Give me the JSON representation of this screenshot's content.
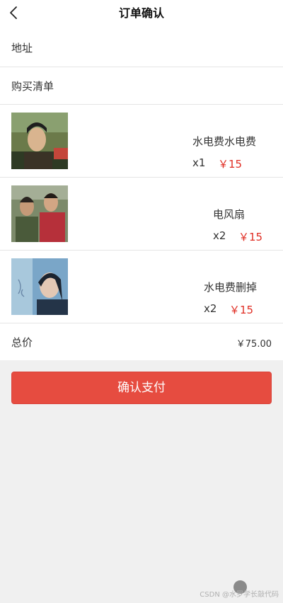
{
  "header": {
    "title": "订单确认",
    "back_icon": "chevron-left-icon"
  },
  "address": {
    "label": "地址"
  },
  "cart": {
    "label": "购买清单"
  },
  "items": [
    {
      "name": "水电费水电费",
      "qty": "x1",
      "price": "￥15"
    },
    {
      "name": "电风扇",
      "qty": "x2",
      "price": "￥15"
    },
    {
      "name": "水电费删掉",
      "qty": "x2",
      "price": "￥15"
    }
  ],
  "total": {
    "label": "总价",
    "value": "￥75.00"
  },
  "pay_button": {
    "label": "确认支付"
  },
  "watermark": "CSDN @水罗学长敲代码",
  "colors": {
    "accent": "#e64c40",
    "price": "#e02e24",
    "background": "#f0f0f0"
  }
}
